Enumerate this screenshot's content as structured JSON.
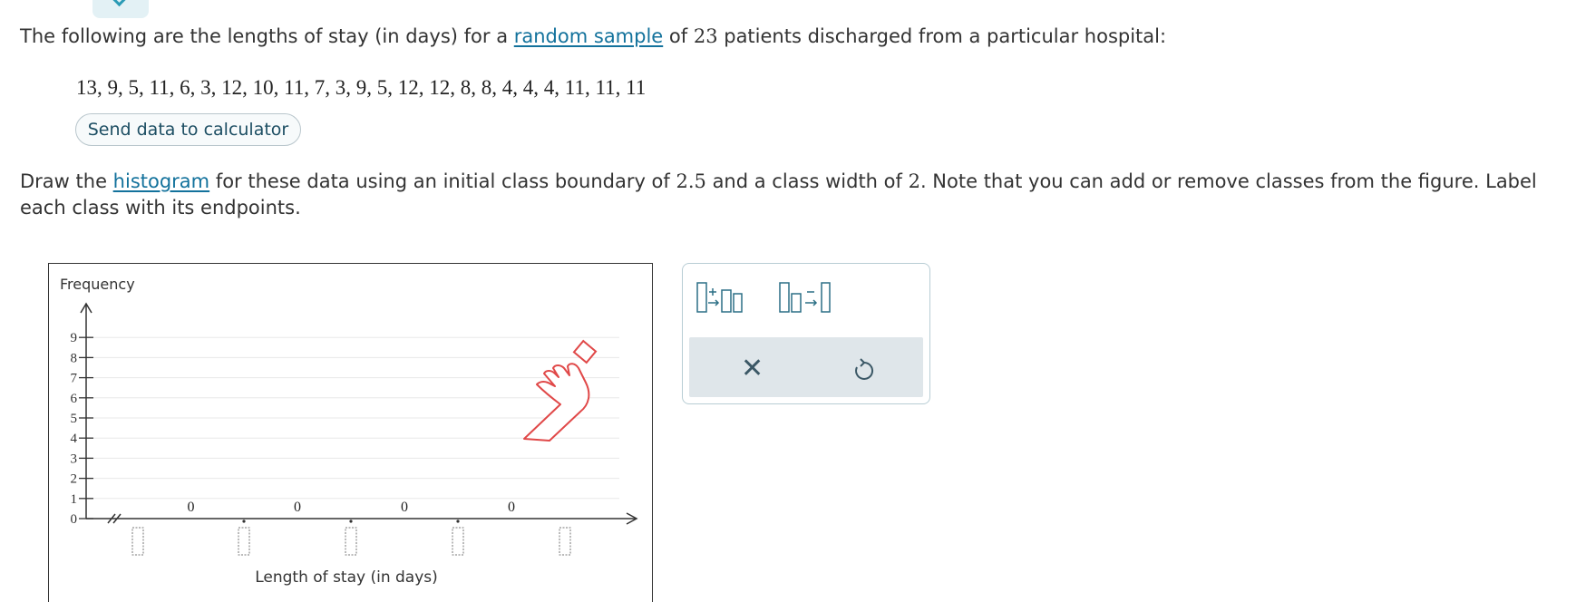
{
  "question": {
    "p1_before": "The following are the lengths of stay (in days) for a ",
    "p1_link": "random sample",
    "p1_mid": " of ",
    "p1_n": "23",
    "p1_after": " patients discharged from a particular hospital:",
    "data_values": "13, 9, 5, 11, 6, 3, 12, 10, 11, 7, 3, 9, 5, 12, 12, 8, 8, 4, 4, 4, 11, 11, 11",
    "send_button": "Send data to calculator",
    "p2_a": "Draw the ",
    "p2_link": "histogram",
    "p2_b": " for these data using an initial class boundary of ",
    "p2_boundary": "2.5",
    "p2_c": " and a class width of ",
    "p2_width": "2",
    "p2_d": ". Note that you can add or remove classes from the figure. Label",
    "p2_line2": "each class with its endpoints."
  },
  "chart_data": {
    "type": "bar",
    "title": "",
    "ylabel": "Frequency",
    "xlabel": "Length of stay (in days)",
    "ylim": [
      0,
      9
    ],
    "y_ticks": [
      "0",
      "1",
      "2",
      "3",
      "4",
      "5",
      "6",
      "7",
      "8",
      "9"
    ],
    "values": [
      0,
      0,
      0,
      0
    ],
    "value_labels": [
      "0",
      "0",
      "0",
      "0"
    ],
    "class_endpoint_labels": [
      "",
      "",
      "",
      "",
      ""
    ]
  },
  "toolbox": {
    "add_class_icon": "add-class-icon",
    "remove_class_icon": "remove-class-icon",
    "clear_icon": "x-icon",
    "undo_icon": "undo-icon"
  },
  "cursor": "hand-pointer-icon",
  "colors": {
    "link": "#13729c",
    "accent": "#2b9bb5",
    "cursor": "#e04848"
  }
}
